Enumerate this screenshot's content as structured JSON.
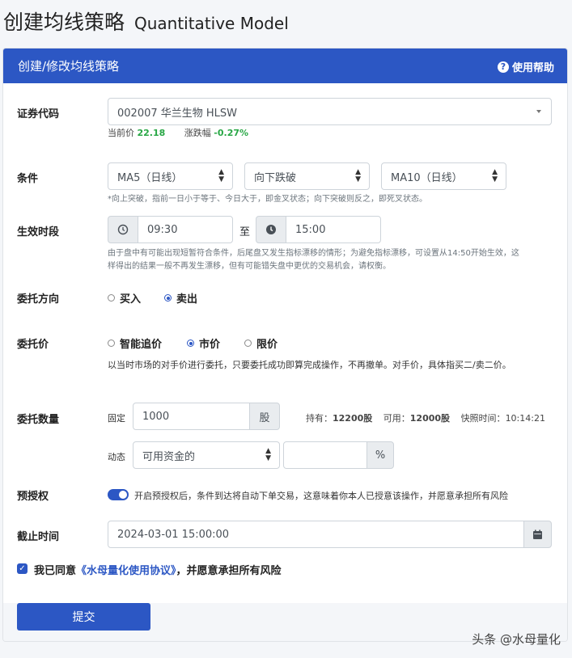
{
  "page": {
    "title": "创建均线策略",
    "subtitle": "Quantitative Model"
  },
  "card": {
    "header_title": "创建/修改均线策略",
    "help_label": "使用帮助"
  },
  "security": {
    "label": "证券代码",
    "value": "002007 华兰生物 HLSW",
    "price_label": "当前价",
    "price_value": "22.18",
    "change_label": "涨跌幅",
    "change_value": "-0.27%"
  },
  "condition": {
    "label": "条件",
    "left_ma": "MA5（日线）",
    "operator": "向下跌破",
    "right_ma": "MA10（日线）",
    "note": "*向上突破，指前一日小于等于、今日大于，即金叉状态；向下突破则反之，即死叉状态。"
  },
  "period": {
    "label": "生效时段",
    "start": "09:30",
    "separator": "至",
    "end": "15:00",
    "note_line1": "由于盘中有可能出现短暂符合条件，后尾盘又发生指标漂移的情形；为避免指标漂移，可设置从14:50开始生效，这",
    "note_line2": "样得出的结果一般不再发生漂移，但有可能错失盘中更优的交易机会，请权衡。"
  },
  "direction": {
    "label": "委托方向",
    "options": [
      "买入",
      "卖出"
    ],
    "selected": "卖出"
  },
  "price": {
    "label": "委托价",
    "options": [
      "智能追价",
      "市价",
      "限价"
    ],
    "selected": "市价",
    "note": "以当时市场的对手价进行委托，只要委托成功即算完成操作，不再撤单。对手价，具体指买二/卖二价。"
  },
  "quantity": {
    "label": "委托数量",
    "fixed_label": "固定",
    "fixed_value": "1000",
    "fixed_unit": "股",
    "holding_label": "持有：",
    "holding_value": "12200股",
    "available_label": "可用：",
    "available_value": "12000股",
    "snapshot_label": "快照时间：",
    "snapshot_value": "10:14:21",
    "dynamic_label": "动态",
    "dynamic_select": "可用资金的",
    "dynamic_value": "",
    "dynamic_unit": "%"
  },
  "preauth": {
    "label": "预授权",
    "enabled": true,
    "text": "开启预授权后，条件到达将自动下单交易，这意味着你本人已授意该操作，并愿意承担所有风险"
  },
  "deadline": {
    "label": "截止时间",
    "value": "2024-03-01 15:00:00"
  },
  "agreement": {
    "checked": true,
    "prefix": "我已同意",
    "link": "《水母量化使用协议》",
    "suffix": "，并愿意承担所有风险"
  },
  "submit_label": "提交",
  "watermark": "头条 @水母量化",
  "colors": {
    "primary": "#2c57c4",
    "positive": "#28a745"
  }
}
